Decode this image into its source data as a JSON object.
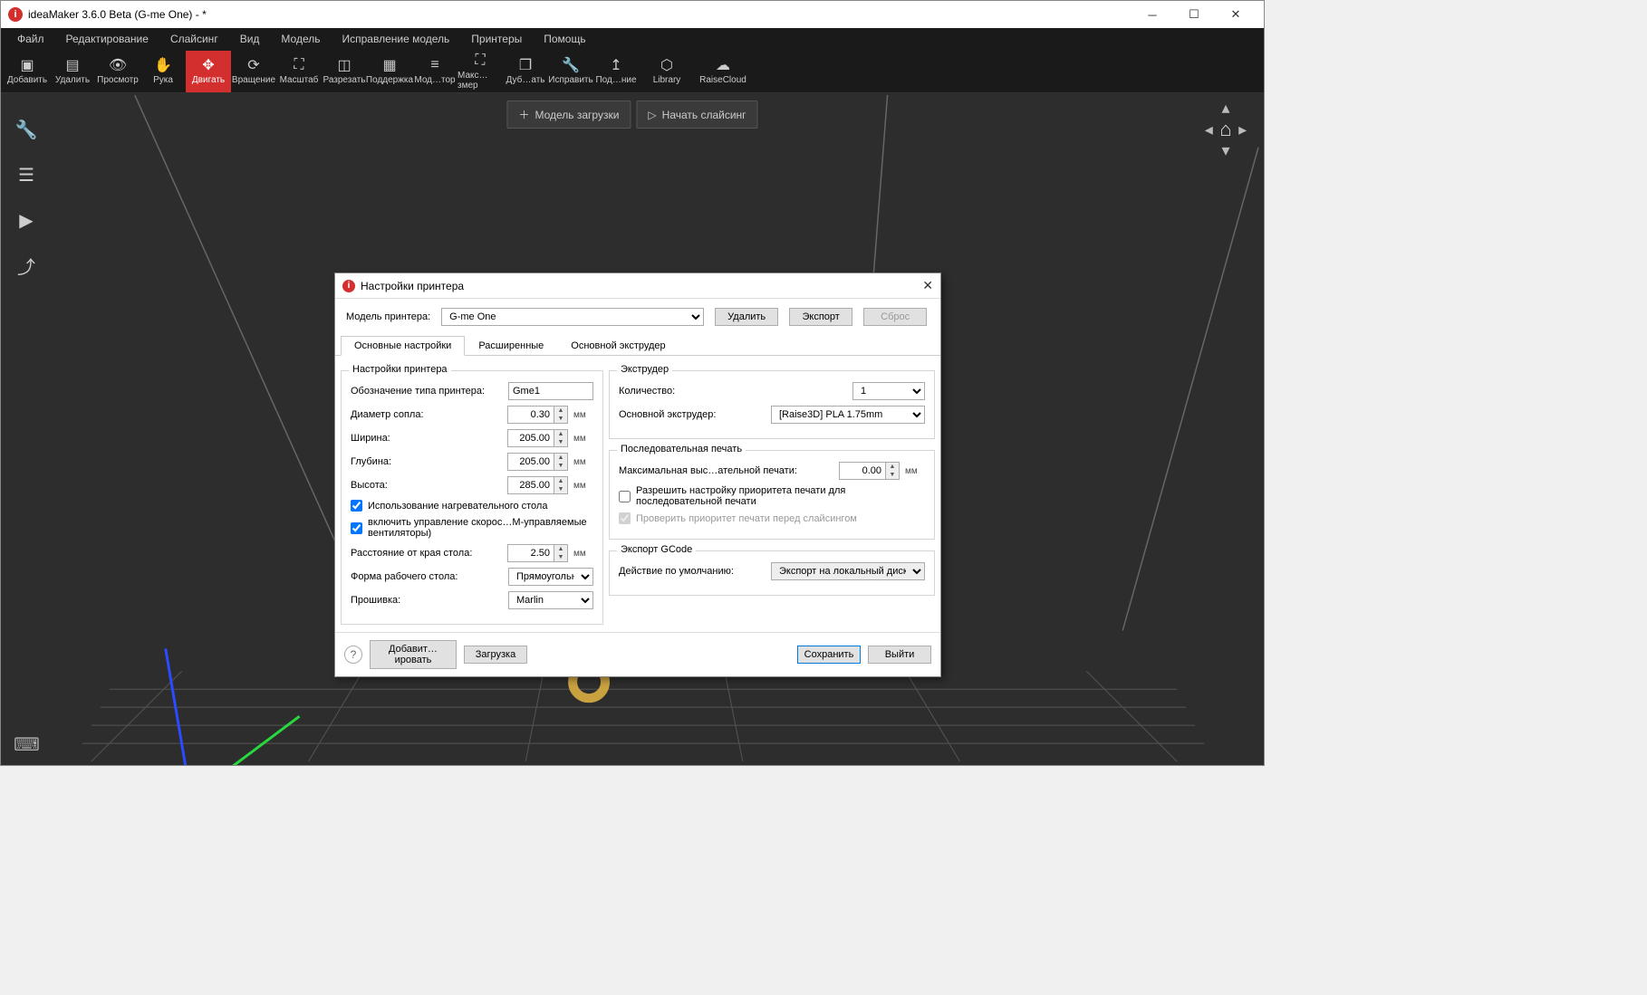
{
  "titlebar": {
    "text": "ideaMaker 3.6.0 Beta (G-me One) - *"
  },
  "menu": [
    "Файл",
    "Редактирование",
    "Слайсинг",
    "Вид",
    "Модель",
    "Исправление модель",
    "Принтеры",
    "Помощь"
  ],
  "toolbar": [
    {
      "id": "add",
      "label": "Добавить"
    },
    {
      "id": "delete",
      "label": "Удалить"
    },
    {
      "id": "view",
      "label": "Просмотр"
    },
    {
      "id": "hand",
      "label": "Рука"
    },
    {
      "id": "move",
      "label": "Двигать",
      "active": true
    },
    {
      "id": "rotate",
      "label": "Вращение"
    },
    {
      "id": "scale",
      "label": "Масштаб"
    },
    {
      "id": "cut",
      "label": "Разрезать"
    },
    {
      "id": "support",
      "label": "Поддержка"
    },
    {
      "id": "modifier",
      "label": "Мод…тор"
    },
    {
      "id": "maxfit",
      "label": "Макс…змер"
    },
    {
      "id": "duplicate",
      "label": "Дуб…ать"
    },
    {
      "id": "fix",
      "label": "Исправить"
    },
    {
      "id": "connection",
      "label": "Под…ние"
    },
    {
      "id": "library",
      "label": "Library"
    },
    {
      "id": "cloud",
      "label": "RaiseCloud"
    }
  ],
  "actionbar": {
    "load": "Модель загрузки",
    "slice": "Начать слайсинг"
  },
  "dialog": {
    "title": "Настройки принтера",
    "modelLabel": "Модель принтера:",
    "modelValue": "G-me One",
    "btnDelete": "Удалить",
    "btnExport": "Экспорт",
    "btnReset": "Сброс",
    "tabs": [
      "Основные настройки",
      "Расширенные",
      "Основной экструдер"
    ],
    "left": {
      "groupTitle": "Настройки принтера",
      "printerNameLabel": "Обозначение типа принтера:",
      "printerNameValue": "Gme1",
      "nozzleLabel": "Диаметр сопла:",
      "nozzleValue": "0.30",
      "widthLabel": "Ширина:",
      "widthValue": "205.00",
      "depthLabel": "Глубина:",
      "depthValue": "205.00",
      "heightLabel": "Высота:",
      "heightValue": "285.00",
      "unit": "мм",
      "heatedBed": "Использование нагревательного стола",
      "fanControl": "включить управление скорос…М-управляемые вентиляторы)",
      "skirtLabel": "Расстояние от края стола:",
      "skirtValue": "2.50",
      "shapeLabel": "Форма рабочего стола:",
      "shapeValue": "Прямоугольник",
      "firmwareLabel": "Прошивка:",
      "firmwareValue": "Marlin"
    },
    "right": {
      "extruderTitle": "Экструдер",
      "countLabel": "Количество:",
      "countValue": "1",
      "primaryLabel": "Основной экструдер:",
      "primaryValue": "[Raise3D] PLA 1.75mm",
      "seqTitle": "Последовательная печать",
      "seqMaxLabel": "Максимальная выс…ательной печати:",
      "seqMaxValue": "0.00",
      "seqAllow": "Разрешить настройку приоритета печати для последовательной печати",
      "seqCheck": "Проверить приоритет печати перед слайсингом",
      "gcodeTitle": "Экспорт GCode",
      "gcodeActionLabel": "Действие по умолчанию:",
      "gcodeActionValue": "Экспорт на локальный диск"
    },
    "footer": {
      "add": "Добавит…ировать",
      "load": "Загрузка",
      "save": "Сохранить",
      "exit": "Выйти"
    }
  }
}
